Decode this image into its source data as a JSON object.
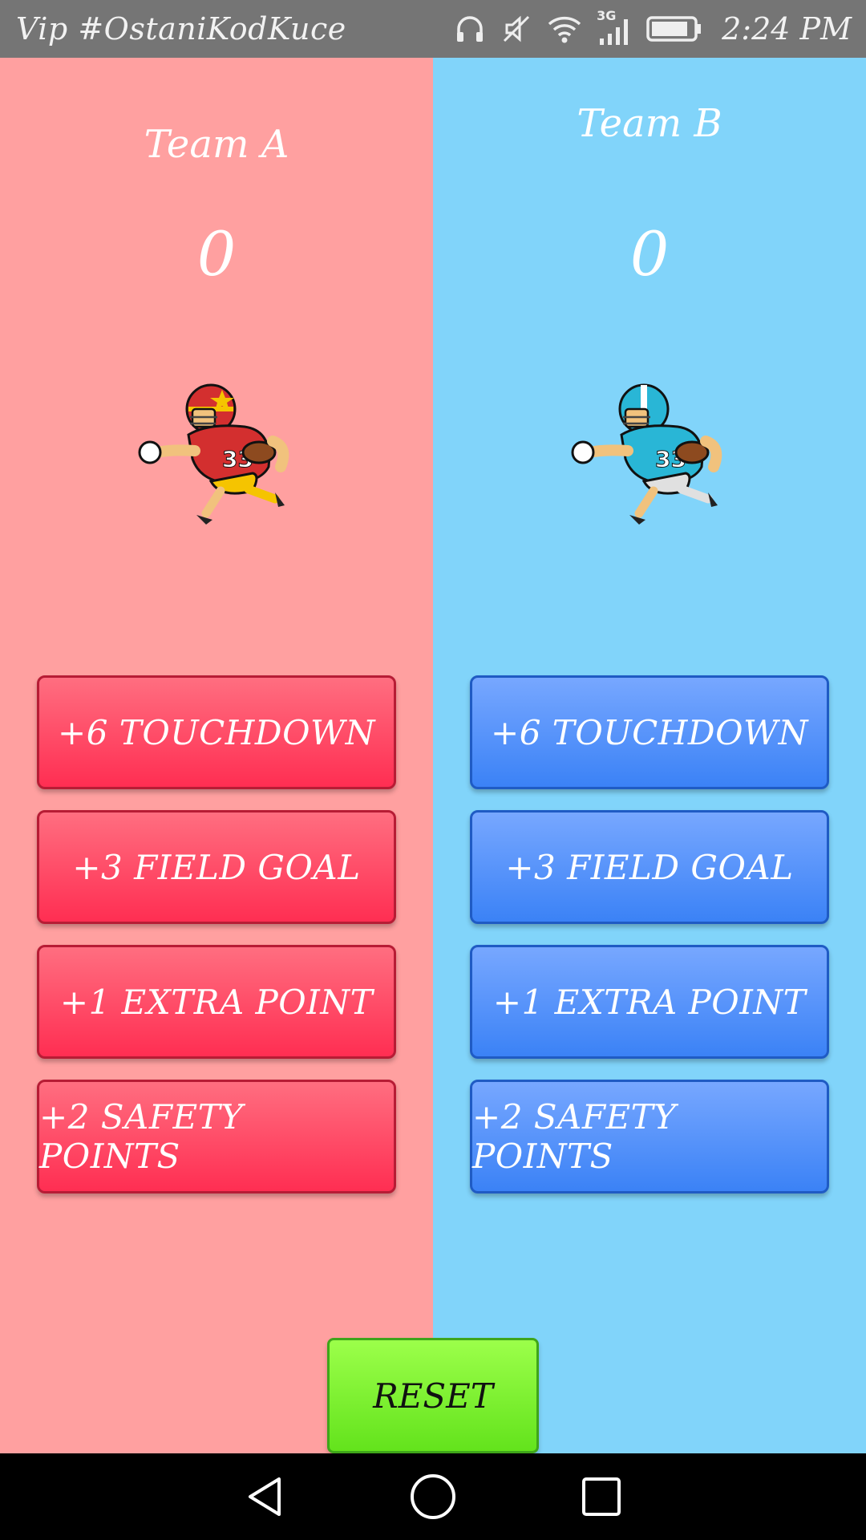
{
  "status_bar": {
    "carrier": "Vip #OstaniKodKuce",
    "network": "3G",
    "time": "2:24 PM"
  },
  "teams": [
    {
      "name": "Team A",
      "score": "0",
      "color": "#ffa0a0",
      "button_color": "#ff2e52",
      "mascot": "football-player-red-icon",
      "buttons": {
        "touchdown": "+6 TOUCHDOWN",
        "field_goal": "+3 FIELD GOAL",
        "extra_point": "+1 EXTRA POINT",
        "safety": "+2 SAFETY POINTS"
      }
    },
    {
      "name": "Team B",
      "score": "0",
      "color": "#81d4fa",
      "button_color": "#3b82f6",
      "mascot": "football-player-teal-icon",
      "buttons": {
        "touchdown": "+6 TOUCHDOWN",
        "field_goal": "+3 FIELD GOAL",
        "extra_point": "+1 EXTRA POINT",
        "safety": "+2 SAFETY POINTS"
      }
    }
  ],
  "reset": {
    "label": "RESET",
    "color": "#63e31c"
  },
  "nav": {
    "back": "back-icon",
    "home": "home-icon",
    "recents": "recents-icon"
  }
}
